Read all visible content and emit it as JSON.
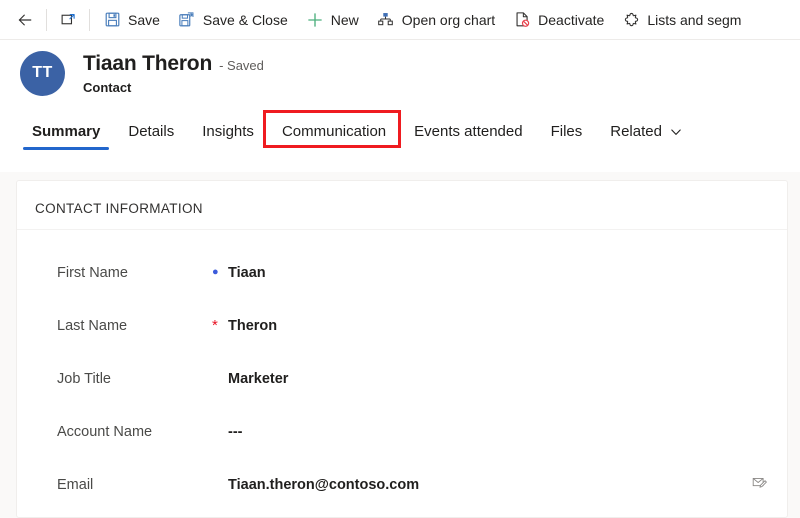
{
  "command_bar": {
    "buttons": [
      {
        "name": "back",
        "label": "",
        "icon": "back-arrow-icon"
      },
      {
        "name": "popout",
        "label": "",
        "icon": "popout-window-icon"
      },
      {
        "name": "save",
        "label": "Save",
        "icon": "save-floppy-icon"
      },
      {
        "name": "save-and-close",
        "label": "Save & Close",
        "icon": "save-and-close-icon"
      },
      {
        "name": "new",
        "label": "New",
        "icon": "plus-icon"
      },
      {
        "name": "open-org-chart",
        "label": "Open org chart",
        "icon": "org-chart-icon"
      },
      {
        "name": "deactivate",
        "label": "Deactivate",
        "icon": "deactivate-icon"
      },
      {
        "name": "lists-and-segments",
        "label": "Lists and segm",
        "icon": "puzzle-piece-icon"
      }
    ]
  },
  "record_header": {
    "avatar_initials": "TT",
    "title": "Tiaan Theron",
    "status": "- Saved",
    "subtitle": "Contact"
  },
  "tabs": [
    {
      "label": "Summary",
      "selected": true,
      "highlighted": false,
      "chevron": false
    },
    {
      "label": "Details",
      "selected": false,
      "highlighted": false,
      "chevron": false
    },
    {
      "label": "Insights",
      "selected": false,
      "highlighted": false,
      "chevron": false
    },
    {
      "label": "Communication",
      "selected": false,
      "highlighted": true,
      "chevron": false
    },
    {
      "label": "Events attended",
      "selected": false,
      "highlighted": false,
      "chevron": false
    },
    {
      "label": "Files",
      "selected": false,
      "highlighted": false,
      "chevron": false
    },
    {
      "label": "Related",
      "selected": false,
      "highlighted": false,
      "chevron": true
    }
  ],
  "form": {
    "section_title": "CONTACT INFORMATION",
    "fields": [
      {
        "label": "First Name",
        "value": "Tiaan",
        "marker": "recommended",
        "action_icon": ""
      },
      {
        "label": "Last Name",
        "value": "Theron",
        "marker": "required",
        "action_icon": ""
      },
      {
        "label": "Job Title",
        "value": "Marketer",
        "marker": "none",
        "action_icon": ""
      },
      {
        "label": "Account Name",
        "value": "---",
        "marker": "none",
        "action_icon": ""
      },
      {
        "label": "Email",
        "value": "Tiaan.theron@contoso.com",
        "marker": "none",
        "action_icon": "compose-email-icon"
      }
    ]
  },
  "colors": {
    "accent_blue": "#2266cc",
    "avatar_blue": "#3b62a5",
    "highlight_red": "#ef1b20",
    "required_red": "#e81123",
    "recommended_blue": "#3b5bdb",
    "new_green": "#4caf7d",
    "form_background": "#faf9f8"
  }
}
